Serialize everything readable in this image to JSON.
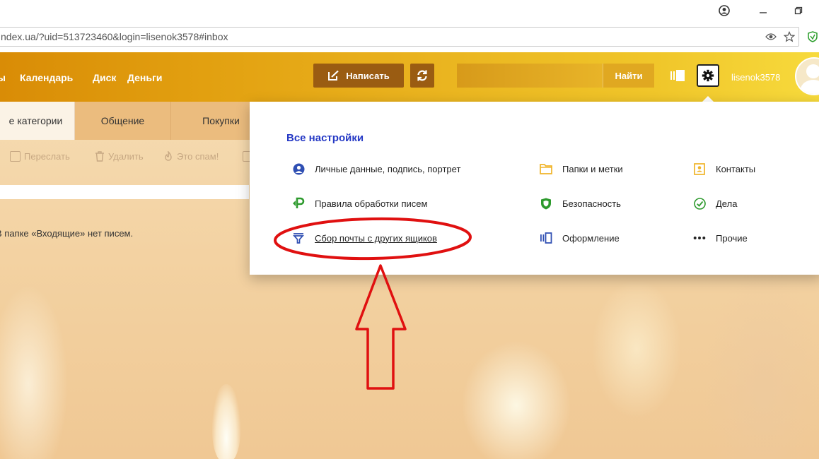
{
  "browser": {
    "url": "ndex.ua/?uid=513723460&login=lisenok3578#inbox",
    "window_buttons": [
      "profile-icon",
      "minimize-icon",
      "restore-icon"
    ]
  },
  "header": {
    "nav": [
      "ы",
      "Календарь",
      "Диск",
      "Деньги"
    ],
    "write_label": "Написать",
    "search_value": "",
    "find_label": "Найти",
    "username": "lisenok3578",
    "accent": "#e2a010"
  },
  "tabs": [
    {
      "label": "е категории",
      "active": true
    },
    {
      "label": "Общение",
      "active": false
    },
    {
      "label": "Покупки",
      "active": false
    }
  ],
  "toolbar": {
    "forward": "Переслать",
    "delete": "Удалить",
    "spam": "Это спам!"
  },
  "mailbox": {
    "empty_message": "В папке «Входящие» нет писем."
  },
  "settings": {
    "title": "Все настройки",
    "title_color": "#2539c5",
    "items": [
      {
        "label": "Личные данные, подпись, портрет",
        "icon": "user-circle-icon"
      },
      {
        "label": "Правила обработки писем",
        "icon": "rules-icon"
      },
      {
        "label": "Сбор почты с других ящиков",
        "icon": "filter-icon"
      },
      {
        "label": "Папки и метки",
        "icon": "folder-icon"
      },
      {
        "label": "Безопасность",
        "icon": "shield-icon"
      },
      {
        "label": "Оформление",
        "icon": "theme-icon"
      },
      {
        "label": "Контакты",
        "icon": "contacts-icon"
      },
      {
        "label": "Дела",
        "icon": "check-icon"
      },
      {
        "label": "Прочие",
        "icon": "more-icon"
      }
    ]
  },
  "annotation": {
    "color": "#e01010"
  }
}
